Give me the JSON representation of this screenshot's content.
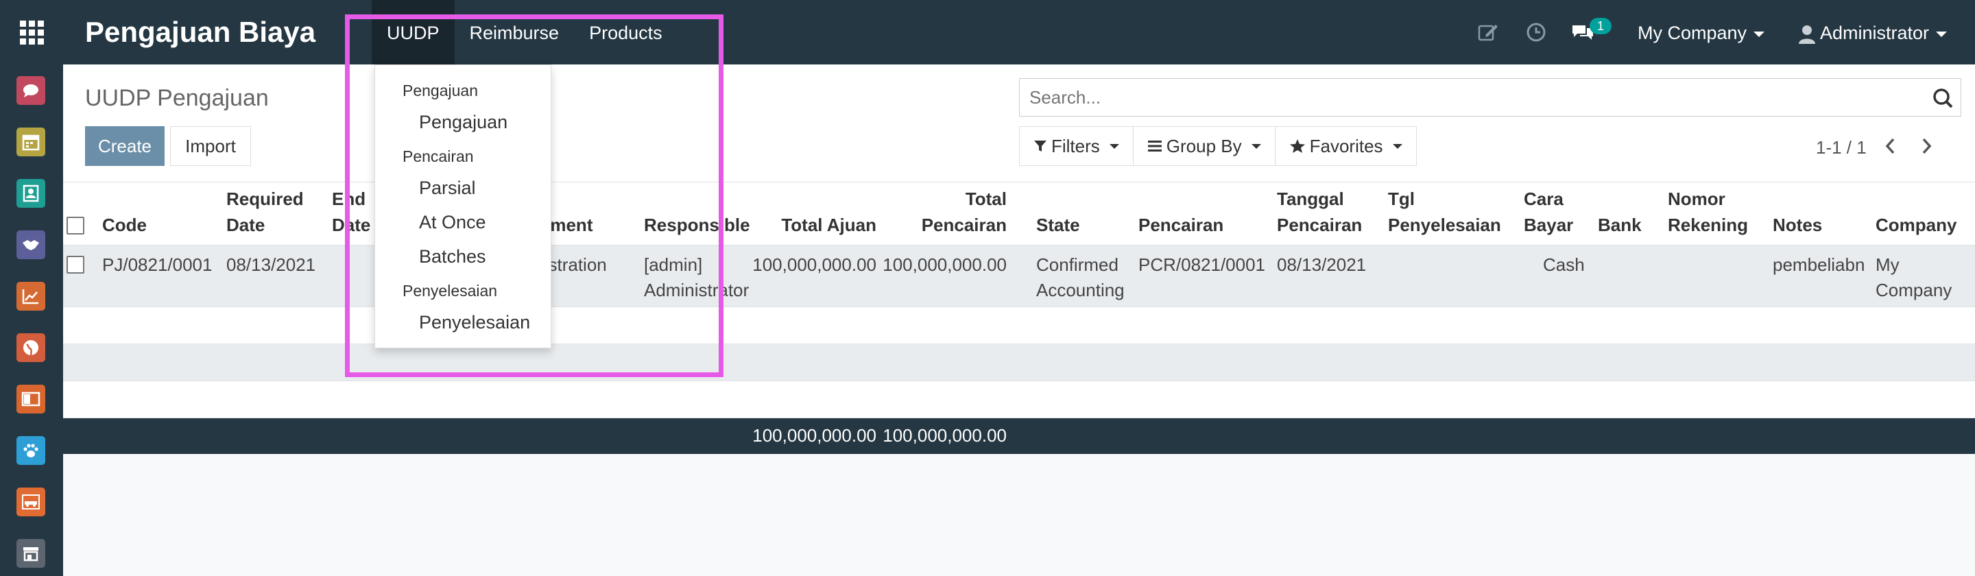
{
  "app": {
    "title": "Pengajuan Biaya"
  },
  "menu": {
    "items": [
      {
        "label": "UUDP"
      },
      {
        "label": "Reimburse"
      },
      {
        "label": "Products"
      }
    ]
  },
  "systray": {
    "messages_count": "1",
    "company": "My Company",
    "user": "Administrator"
  },
  "dropdown": {
    "sections": [
      {
        "header": "Pengajuan",
        "items": [
          "Pengajuan"
        ]
      },
      {
        "header": "Pencairan",
        "items": [
          "Parsial",
          "At Once",
          "Batches"
        ]
      },
      {
        "header": "Penyelesaian",
        "items": [
          "Penyelesaian"
        ]
      }
    ]
  },
  "control_panel": {
    "title": "UUDP Pengajuan",
    "create_label": "Create",
    "import_label": "Import",
    "search_placeholder": "Search...",
    "filters_label": "Filters",
    "groupby_label": "Group By",
    "favorites_label": "Favorites",
    "pager": "1-1 / 1"
  },
  "table": {
    "headers": {
      "code": "Code",
      "required_date_1": "Required",
      "required_date_2": "Date",
      "end_date_1": "End",
      "end_date_2": "Date",
      "department": "Department",
      "responsible": "Responsible",
      "total_ajuan": "Total Ajuan",
      "total_pencairan_1": "Total",
      "total_pencairan_2": "Pencairan",
      "state": "State",
      "pencairan": "Pencairan",
      "tanggal_pencairan_1": "Tanggal",
      "tanggal_pencairan_2": "Pencairan",
      "tgl_penyelesaian_1": "Tgl",
      "tgl_penyelesaian_2": "Penyelesaian",
      "cara_bayar_1": "Cara",
      "cara_bayar_2": "Bayar",
      "bank": "Bank",
      "nomor_rekening_1": "Nomor",
      "nomor_rekening_2": "Rekening",
      "notes": "Notes",
      "company": "Company"
    },
    "rows": [
      {
        "code": "PJ/0821/0001",
        "required_date": "08/13/2021",
        "department": "Administration",
        "responsible_1": "[admin]",
        "responsible_2": "Administrator",
        "total_ajuan": "100,000,000.00",
        "total_pencairan": "100,000,000.00",
        "state_1": "Confirmed",
        "state_2": "Accounting",
        "pencairan": "PCR/0821/0001",
        "tanggal_pencairan": "08/13/2021",
        "cara_bayar": "Cash",
        "notes": "pembeliabn",
        "company_1": "My",
        "company_2": "Company"
      }
    ],
    "footer": {
      "total_ajuan": "100,000,000.00",
      "total_pencairan": "100,000,000.00"
    }
  },
  "sidebar": {
    "icons": [
      {
        "name": "discuss-icon",
        "color": "#c2485f"
      },
      {
        "name": "calendar-icon",
        "color": "#b5a542"
      },
      {
        "name": "contacts-icon",
        "color": "#1f9e94"
      },
      {
        "name": "crm-icon",
        "color": "#5c5f99"
      },
      {
        "name": "sales-icon",
        "color": "#d66a33"
      },
      {
        "name": "website-icon",
        "color": "#d45d3d"
      },
      {
        "name": "documents-icon",
        "color": "#d9662f"
      },
      {
        "name": "paw-icon",
        "color": "#2e9fd6"
      },
      {
        "name": "fleet-icon",
        "color": "#e06b33"
      },
      {
        "name": "store-icon",
        "color": "#5d6670"
      }
    ]
  }
}
